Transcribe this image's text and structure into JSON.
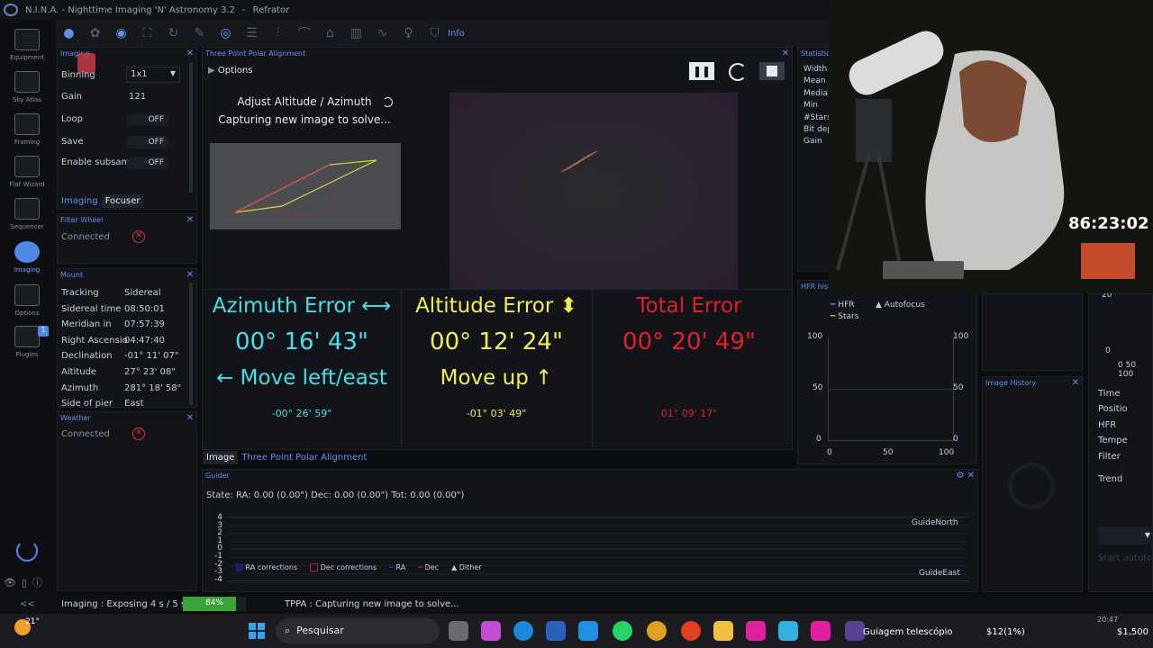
{
  "app": {
    "title": "N.I.N.A. - Nighttime Imaging 'N' Astronomy 3.2",
    "profile": "Refrator"
  },
  "nav": [
    "Equipment",
    "Sky Atlas",
    "Framing",
    "Flat Wizard",
    "Sequencer",
    "Imaging",
    "Options",
    "Plugins"
  ],
  "plugins_badge": "1",
  "toolbar": {
    "info_label": "Info"
  },
  "imaging": {
    "title": "Imaging",
    "binning_label": "Binning",
    "binning_value": "1x1",
    "gain_label": "Gain",
    "gain_value": "121",
    "loop_label": "Loop",
    "loop_value": "OFF",
    "save_label": "Save",
    "save_value": "OFF",
    "subsample_label": "Enable subsam",
    "subsample_value": "OFF",
    "tab_imaging": "Imaging",
    "tab_focuser": "Focuser"
  },
  "filter_wheel": {
    "title": "Filter Wheel",
    "status": "Connected"
  },
  "mount": {
    "title": "Mount",
    "rows": [
      {
        "label": "Tracking",
        "value": "Sidereal"
      },
      {
        "label": "Sidereal time",
        "value": "08:50:01"
      },
      {
        "label": "Meridian in",
        "value": "07:57:39"
      },
      {
        "label": "Right Ascensio",
        "value": "04:47:40"
      },
      {
        "label": "Declination",
        "value": "-01° 11' 07\""
      },
      {
        "label": "Altitude",
        "value": "27° 23' 08\""
      },
      {
        "label": "Azimuth",
        "value": "281° 18' 58\""
      },
      {
        "label": "Side of pier",
        "value": "East"
      }
    ]
  },
  "weather": {
    "title": "Weather",
    "status": "Connected"
  },
  "tppa": {
    "title": "Three Point Polar Alignment",
    "options_label": "Options",
    "step_title": "Adjust Altitude / Azimuth",
    "step_status": "Capturing new image to solve...",
    "azimuth": {
      "label": "Azimuth Error ⟷",
      "value": "00° 16' 43\"",
      "move": "← Move left/east",
      "sub": "-00° 26' 59\"",
      "color": "#45e0e6"
    },
    "altitude": {
      "label": "Altitude Error ⬍",
      "value": "00° 12' 24\"",
      "move": "Move up ↑",
      "sub": "-01° 03' 49\"",
      "color": "#f2ee52"
    },
    "total": {
      "label": "Total Error",
      "value": "00° 20' 49\"",
      "sub": "01° 09' 17\"",
      "color": "#e0202c"
    },
    "tab_image": "Image",
    "tab_tppa": "Three Point Polar Alignment"
  },
  "statistics": {
    "title": "Statistics",
    "labels": [
      "Width",
      "Mean",
      "Media",
      "Min",
      "#Stars",
      "Bit dep",
      "Gain"
    ]
  },
  "hfr": {
    "title": "HFR histo",
    "legend_hfr": "HFR",
    "legend_stars": "Stars",
    "legend_autofocus": "Autofocus",
    "yticks": [
      "100",
      "50",
      "0"
    ],
    "xticks": [
      "0",
      "50",
      "100"
    ]
  },
  "image_history": {
    "title": "Image History"
  },
  "side_right": {
    "labels": [
      "Time",
      "Positio",
      "HFR",
      "Tempe",
      "Filter",
      "Trend"
    ],
    "mini_ticks": [
      "20",
      "0",
      "0 50 100"
    ],
    "button": "Start autofo"
  },
  "guider": {
    "title": "Guider",
    "state": "State:  RA: 0.00 (0.00\")  Dec: 0.00 (0.00\")  Tot: 0.00 (0.00\")",
    "yticks": [
      "4",
      "3",
      "2",
      "1",
      "0",
      "-1",
      "-2",
      "-3",
      "-4"
    ],
    "label_north": "GuideNorth",
    "label_east": "GuideEast",
    "legend": [
      "RA corrections",
      "Dec corrections",
      "RA",
      "Dec",
      "Dither"
    ]
  },
  "status": {
    "imaging": "Imaging :   Exposing 4 s / 5 s",
    "progress": 84,
    "progress_label": "84%",
    "tppa": "TPPA :   Capturing new image to solve..."
  },
  "webcam": {
    "timer": "86:23:02"
  },
  "taskbar": {
    "temp": "21°",
    "search": "Pesquisar",
    "window": "Guiagem telescópio",
    "ticker1": "$12(1%)",
    "ticker2": "$1,500",
    "clock": "20:47"
  }
}
